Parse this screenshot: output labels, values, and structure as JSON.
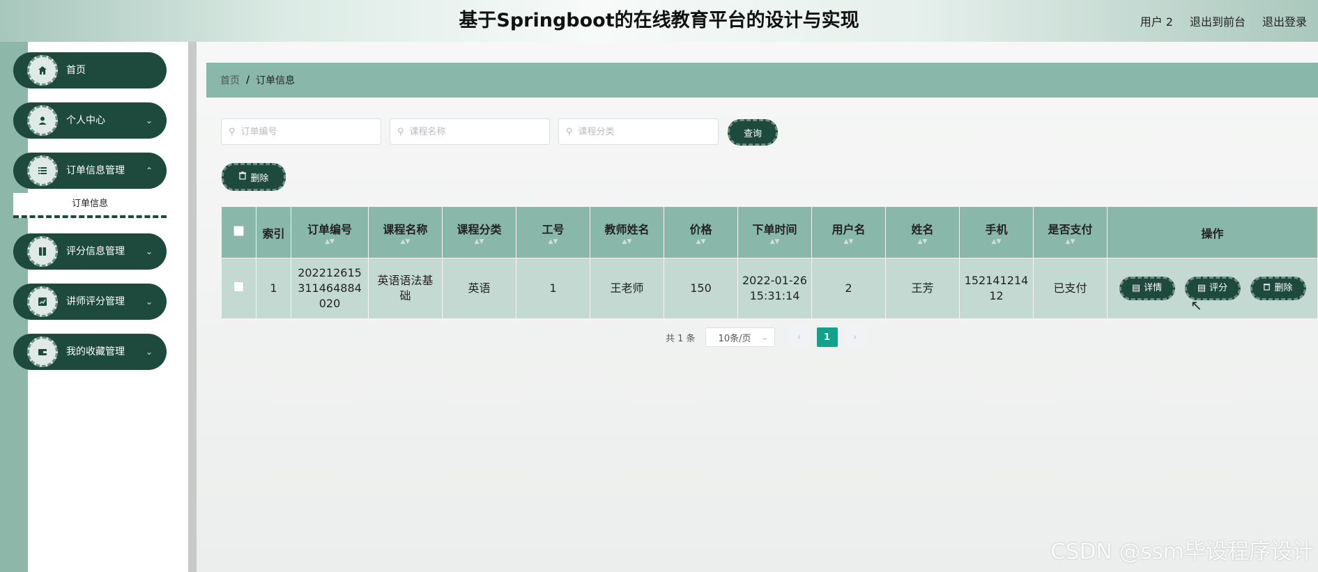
{
  "header": {
    "title": "基于Springboot的在线教育平台的设计与实现",
    "user": "用户 2",
    "back_to_front": "退出到前台",
    "logout": "退出登录"
  },
  "sidebar": {
    "items": [
      {
        "label": "首页",
        "icon": "home-icon"
      },
      {
        "label": "个人中心",
        "icon": "user-icon"
      },
      {
        "label": "订单信息管理",
        "icon": "list-icon"
      },
      {
        "label": "评分信息管理",
        "icon": "book-icon"
      },
      {
        "label": "讲师评分管理",
        "icon": "chart-icon"
      },
      {
        "label": "我的收藏管理",
        "icon": "wallet-icon"
      }
    ],
    "submenu": {
      "label": "订单信息"
    }
  },
  "breadcrumb": {
    "home": "首页",
    "separator": "/",
    "current": "订单信息"
  },
  "search": {
    "order_no_placeholder": "订单编号",
    "course_name_placeholder": "课程名称",
    "course_category_placeholder": "课程分类",
    "query_label": "查询"
  },
  "toolbar": {
    "delete_label": "删除"
  },
  "table": {
    "columns": [
      "索引",
      "订单编号",
      "课程名称",
      "课程分类",
      "工号",
      "教师姓名",
      "价格",
      "下单时间",
      "用户名",
      "姓名",
      "手机",
      "是否支付",
      "操作"
    ],
    "rows": [
      {
        "index": "1",
        "order_no": "202212615311464884020",
        "course_name": "英语语法基础",
        "course_category": "英语",
        "staff_no": "1",
        "teacher_name": "王老师",
        "price": "150",
        "order_time": "2022-01-26 15:31:14",
        "username": "2",
        "name": "王芳",
        "phone": "15214121412",
        "paid": "已支付"
      }
    ],
    "actions": {
      "detail": "详情",
      "rate": "评分",
      "delete": "删除"
    }
  },
  "pagination": {
    "total": "共 1 条",
    "page_size": "10条/页",
    "current_page": "1"
  },
  "watermark": "CSDN @ssm毕设程序设计",
  "colors": {
    "primary": "#1d4a3d",
    "table_header": "#89b7a9",
    "table_row": "#c4d9d2",
    "page_active": "#12a189"
  }
}
